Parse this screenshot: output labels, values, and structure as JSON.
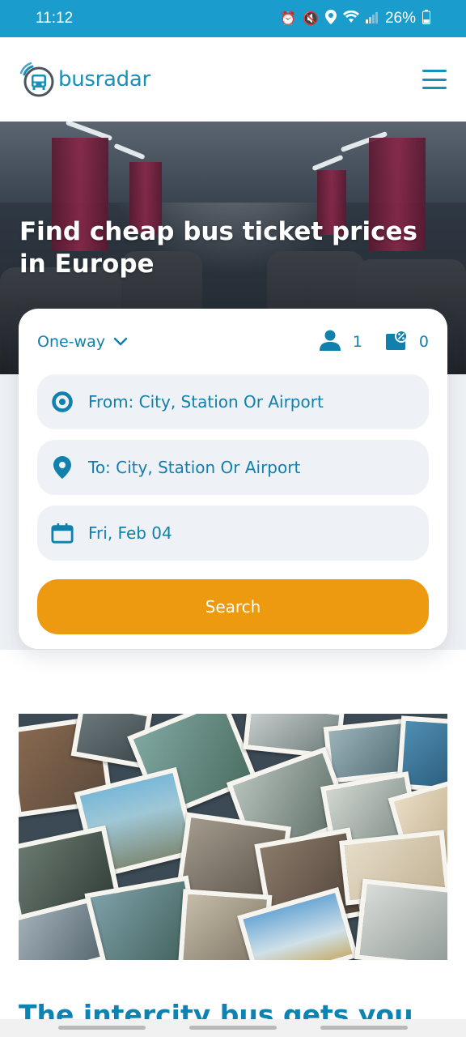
{
  "status_bar": {
    "time": "11:12",
    "battery": "26%",
    "icons": [
      "alarm-icon",
      "mute-icon",
      "location-icon",
      "wifi-icon",
      "signal-icon",
      "battery-icon"
    ]
  },
  "header": {
    "logo_text": "busradar",
    "menu_icon": "hamburger-menu-icon"
  },
  "hero": {
    "title": "Find cheap bus ticket prices in Europe"
  },
  "search": {
    "trip_type": "One-way",
    "passengers": "1",
    "discount_cards": "0",
    "from_placeholder": "From: City, Station Or Airport",
    "to_placeholder": "To: City, Station Or Airport",
    "date": "Fri, Feb 04",
    "search_label": "Search"
  },
  "content": {
    "section_title": "The intercity bus gets you"
  },
  "colors": {
    "brand": "#1a8fb8",
    "status_bar": "#1a9ccc",
    "accent": "#ee9a10",
    "field_bg": "#eef1f5"
  }
}
